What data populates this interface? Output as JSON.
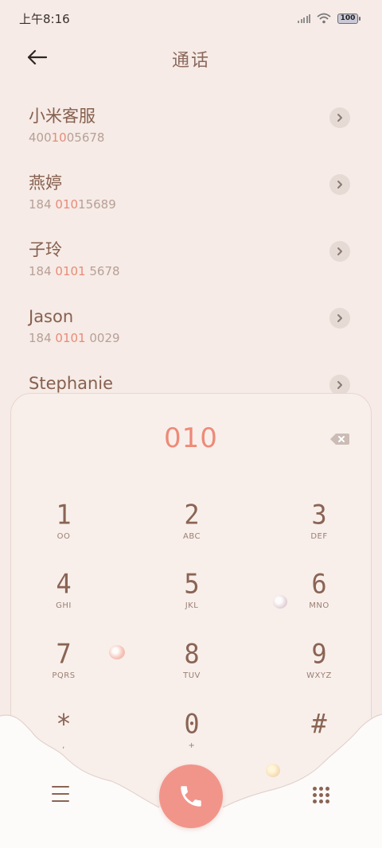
{
  "status": {
    "time": "上午8:16",
    "battery": "100"
  },
  "header": {
    "title": "通话"
  },
  "contacts": [
    {
      "name": "小米客服",
      "number_pre": "400",
      "number_hl": "10",
      "number_post": "05678"
    },
    {
      "name": "燕婷",
      "number_pre": "184 ",
      "number_hl": "010",
      "number_post": "15689"
    },
    {
      "name": "子玲",
      "number_pre": "184 ",
      "number_hl": "0101",
      "number_post": " 5678"
    },
    {
      "name": "Jason",
      "number_pre": "184 ",
      "number_hl": "0101",
      "number_post": " 0029"
    },
    {
      "name": "Stephanie",
      "number_pre": "",
      "number_hl": "",
      "number_post": ""
    }
  ],
  "dialpad": {
    "input": "010",
    "keys": [
      {
        "digit": "1",
        "letters": "OO"
      },
      {
        "digit": "2",
        "letters": "ABC"
      },
      {
        "digit": "3",
        "letters": "DEF"
      },
      {
        "digit": "4",
        "letters": "GHI"
      },
      {
        "digit": "5",
        "letters": "JKL"
      },
      {
        "digit": "6",
        "letters": "MNO"
      },
      {
        "digit": "7",
        "letters": "PQRS"
      },
      {
        "digit": "8",
        "letters": "TUV"
      },
      {
        "digit": "9",
        "letters": "WXYZ"
      },
      {
        "digit": "*",
        "letters": ","
      },
      {
        "digit": "0",
        "letters": "+"
      },
      {
        "digit": "#",
        "letters": ""
      }
    ]
  },
  "colors": {
    "accent": "#ee8a77",
    "call_button": "#f1958a",
    "background": "#f6ebe6",
    "text": "#86604f"
  }
}
